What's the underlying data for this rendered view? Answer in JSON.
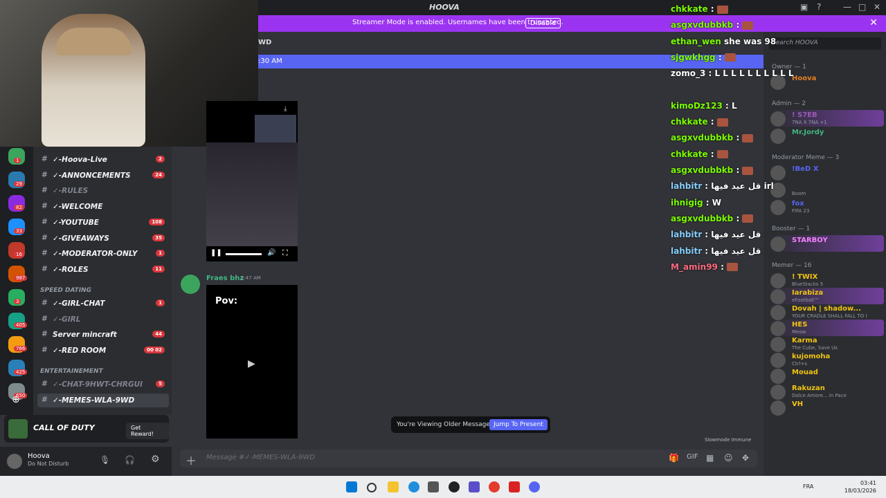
{
  "window": {
    "title": "HOOVA"
  },
  "banner": {
    "text": "Streamer Mode is enabled. Usernames have been truncated.",
    "button": "Disable"
  },
  "header": {
    "channel": "WD",
    "new_messages_time": ":30 AM"
  },
  "servers": [
    {
      "badge": "1"
    },
    {
      "badge": "29"
    },
    {
      "badge": "82"
    },
    {
      "badge": "33"
    },
    {
      "badge": "16"
    },
    {
      "badge": "987"
    },
    {
      "badge": "3"
    },
    {
      "badge": "405"
    },
    {
      "badge": "766"
    },
    {
      "badge": "425"
    },
    {
      "badge": "650"
    }
  ],
  "channels": [
    {
      "name": "✓-Hoova-Live",
      "badge": "2"
    },
    {
      "name": "✓-ANNONCEMENTS",
      "badge": "24"
    },
    {
      "name": "✓-RULES",
      "badge": ""
    },
    {
      "name": "✓-WELCOME",
      "badge": ""
    },
    {
      "name": "✓-YOUTUBE",
      "badge": "108"
    },
    {
      "name": "✓-GIVEAWAYS",
      "badge": "35"
    },
    {
      "name": "✓-MODERATOR-ONLY",
      "badge": "1"
    },
    {
      "name": "✓-ROLES",
      "badge": "11"
    }
  ],
  "category_speed": "SPEED DATING",
  "channels2": [
    {
      "name": "✓-GIRL-CHAT",
      "badge": "1"
    },
    {
      "name": "✓-GIRL",
      "badge": ""
    },
    {
      "name": "Server mincraft",
      "badge": "44"
    },
    {
      "name": "✓-RED ROOM",
      "badge": "00 02"
    }
  ],
  "category_ent": "ENTERTAINEMENT",
  "channels3": [
    {
      "name": "✓-CHAT-9HWT-CHRGUI",
      "badge": "5"
    },
    {
      "name": "✓-MEMES-WLA-9WD",
      "badge": ""
    }
  ],
  "promo": {
    "title": "CALL OF DUTY",
    "button": "Get Reward!"
  },
  "user": {
    "name": "Hoova",
    "status": "Do Not Disturb"
  },
  "message": {
    "author": "Fraes bhz",
    "time": "2:47 AM",
    "video_text": "Pov:"
  },
  "older": {
    "text": "You're Viewing Older Messages",
    "button": "Jump To Present"
  },
  "composer": {
    "placeholder": "Message #✓-MEMES-WLA-9WD"
  },
  "slowmode": "Slowmode Immune",
  "members": {
    "search": "Search HOOVA",
    "groups": [
      {
        "label": "Owner — 1",
        "members": [
          {
            "name": "Hoova",
            "sub": "",
            "color": "#e67e22"
          }
        ]
      },
      {
        "label": "Admin — 2",
        "members": [
          {
            "name": "! S7EB",
            "sub": "7NA X 7NA +1",
            "color": "#9b59b6"
          },
          {
            "name": "Mr.Jordy",
            "sub": "",
            "color": "#43b581"
          }
        ]
      },
      {
        "label": "Moderator Meme — 3",
        "members": [
          {
            "name": "!BeD X",
            "sub": "",
            "color": "#5865f2"
          },
          {
            "name": "",
            "sub": "Boom",
            "color": "#aaa"
          },
          {
            "name": "fox",
            "sub": "FIFA 23",
            "color": "#5865f2"
          }
        ]
      },
      {
        "label": "Booster — 1",
        "members": [
          {
            "name": "STARBOY",
            "sub": "",
            "color": "#f47fff"
          }
        ]
      },
      {
        "label": "Memer — 16",
        "members": [
          {
            "name": "! TWIX",
            "sub": "BlueStacks 5",
            "color": "#f1c40f"
          },
          {
            "name": "Iarabiza",
            "sub": "eFootball™",
            "color": "#f1c40f"
          },
          {
            "name": "Dovah | shadow...",
            "sub": "YOUR CRADLE SHALL FALL TO I",
            "color": "#f1c40f"
          },
          {
            "name": "HES",
            "sub": "Meow",
            "color": "#f1c40f"
          },
          {
            "name": "Karma",
            "sub": "The Cube, Save Us",
            "color": "#f1c40f"
          },
          {
            "name": "kujomoha",
            "sub": "Ctrl+s",
            "color": "#f1c40f"
          },
          {
            "name": "Mouad",
            "sub": "",
            "color": "#f1c40f"
          },
          {
            "name": "Rakuzan",
            "sub": "Dolce Amore... in Pace",
            "color": "#f1c40f"
          },
          {
            "name": "VH",
            "sub": "",
            "color": "#f1c40f"
          }
        ]
      }
    ]
  },
  "overlay_chat": [
    {
      "user": "chkkate",
      "text": " : ",
      "color": "#7cfc00"
    },
    {
      "user": "asgxvdubbkb",
      "text": " : ",
      "color": "#7cfc00"
    },
    {
      "user": "ethan_wen",
      "text": " she was 98",
      "color": "#7cfc00"
    },
    {
      "user": "sjgwkhgg",
      "text": " : ",
      "color": "#7cfc00"
    },
    {
      "user": "zomo_3",
      "text": " :  L  L  L  L  L  L  L  L  L  L",
      "color": "#ffffff"
    },
    {
      "user": "",
      "text": "",
      "color": "#ffffff"
    },
    {
      "user": "kimoDz123",
      "text": " :  L",
      "color": "#7cfc00"
    },
    {
      "user": "chkkate",
      "text": " : ",
      "color": "#7cfc00"
    },
    {
      "user": "asgxvdubbkb",
      "text": " : ",
      "color": "#7cfc00"
    },
    {
      "user": "chkkate",
      "text": " : ",
      "color": "#7cfc00"
    },
    {
      "user": "asgxvdubbkb",
      "text": " : ",
      "color": "#7cfc00"
    },
    {
      "user": "lahbitr",
      "text": " : قل عيد فيها irl",
      "color": "#87cefa"
    },
    {
      "user": "ihnigig",
      "text": " :  W",
      "color": "#7cfc00"
    },
    {
      "user": "asgxvdubbkb",
      "text": " : ",
      "color": "#7cfc00"
    },
    {
      "user": "lahbitr",
      "text": " : قل عيد فيها",
      "color": "#87cefa"
    },
    {
      "user": "lahbitr",
      "text": " : قل عيد فيها",
      "color": "#87cefa"
    },
    {
      "user": "M_amin99",
      "text": " : ",
      "color": "#ff6b81"
    }
  ],
  "taskbar": {
    "lang": "FRA",
    "time": "03:41",
    "date": "18/03/2026"
  }
}
